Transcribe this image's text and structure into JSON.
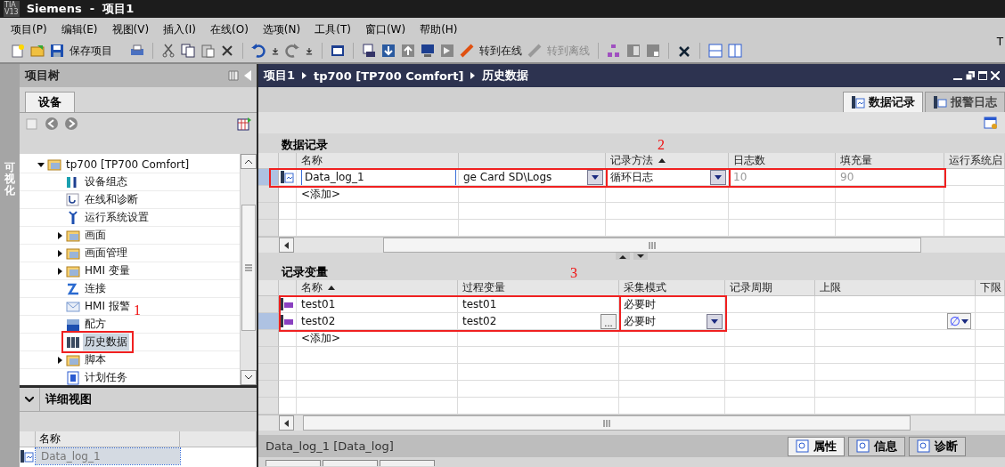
{
  "window": {
    "logo": [
      "TIA",
      "V13"
    ],
    "title": "Siemens  -  项目1"
  },
  "menu": [
    "项目(P)",
    "编辑(E)",
    "视图(V)",
    "插入(I)",
    "在线(O)",
    "选项(N)",
    "工具(T)",
    "窗口(W)",
    "帮助(H)"
  ],
  "toolbar": {
    "buttons": [
      {
        "label": "保存项目",
        "disabled": false
      },
      {
        "label": "转到在线",
        "disabled": false
      },
      {
        "label": "转到离线",
        "disabled": true
      }
    ],
    "corner_text": "T"
  },
  "side_strip": {
    "label": "可视化"
  },
  "project_tree": {
    "title": "项目树",
    "tabs": [
      {
        "label": "设备",
        "selected": true
      }
    ],
    "items": [
      {
        "label": "tp700 [TP700 Comfort]",
        "expanded": true,
        "selected": false,
        "children": [
          {
            "label": "设备组态",
            "selected": false
          },
          {
            "label": "在线和诊断",
            "selected": false
          },
          {
            "label": "运行系统设置",
            "selected": false
          },
          {
            "label": "画面",
            "expanded": false,
            "selected": false
          },
          {
            "label": "画面管理",
            "expanded": false,
            "selected": false
          },
          {
            "label": "HMI 变量",
            "expanded": false,
            "selected": false
          },
          {
            "label": "连接",
            "selected": false
          },
          {
            "label": "HMI 报警",
            "selected": false
          },
          {
            "label": "配方",
            "selected": false
          },
          {
            "label": "历史数据",
            "selected": true
          },
          {
            "label": "脚本",
            "expanded": false,
            "selected": false
          },
          {
            "label": "计划任务",
            "selected": false
          }
        ]
      }
    ]
  },
  "detail_view": {
    "title": "详细视图",
    "expanded": true,
    "columns": [
      "名称"
    ],
    "rows": [
      {
        "name": "Data_log_1",
        "selected": true
      }
    ]
  },
  "editor": {
    "breadcrumb": [
      "项目1",
      "tp700 [TP700 Comfort]",
      "历史数据"
    ],
    "tabs": [
      {
        "label": "数据记录",
        "selected": true
      },
      {
        "label": "报警日志",
        "selected": false
      }
    ],
    "data_logs": {
      "title": "数据记录",
      "columns": [
        {
          "label": "名称"
        },
        {
          "label": "记录方法",
          "sorted": true
        },
        {
          "label": "日志数"
        },
        {
          "label": "填充量"
        },
        {
          "label": "运行系统启"
        }
      ],
      "rows": [
        {
          "kind": "item",
          "selected": true,
          "cells": [
            {
              "kind": "edit",
              "text": "Data_log_1"
            },
            {
              "kind": "dropdown",
              "text": "ge Card SD\\Logs"
            },
            {
              "kind": "dropdown",
              "text": "循环日志"
            },
            {
              "kind": "disabled",
              "text": "10"
            },
            {
              "kind": "disabled",
              "text": "90"
            },
            {
              "kind": "empty"
            }
          ]
        },
        {
          "kind": "add",
          "selected": false,
          "text": "<添加>"
        }
      ]
    },
    "log_tags": {
      "title": "记录变量",
      "columns": [
        {
          "label": "名称",
          "sorted": true
        },
        {
          "label": "过程变量"
        },
        {
          "label": "采集模式"
        },
        {
          "label": "记录周期"
        },
        {
          "label": "上限"
        },
        {
          "label": "下限"
        }
      ],
      "rows": [
        {
          "kind": "item",
          "selected": false,
          "cells": [
            {
              "kind": "plain",
              "text": "test01"
            },
            {
              "kind": "plain",
              "text": "test01"
            },
            {
              "kind": "plain",
              "text": "必要时"
            },
            {
              "kind": "empty"
            },
            {
              "kind": "empty"
            },
            {
              "kind": "empty"
            }
          ]
        },
        {
          "kind": "item",
          "selected": true,
          "cells": [
            {
              "kind": "plain",
              "text": "test02"
            },
            {
              "kind": "browse",
              "text": "test02",
              "button": "..."
            },
            {
              "kind": "dropdown",
              "text": "必要时"
            },
            {
              "kind": "empty"
            },
            {
              "kind": "symbol_dropdown",
              "text": "∅"
            },
            {
              "kind": "empty"
            }
          ]
        },
        {
          "kind": "add",
          "selected": false,
          "text": "<添加>"
        }
      ]
    }
  },
  "inspector": {
    "title": "Data_log_1 [Data_log]",
    "tabs": [
      {
        "label": "属性",
        "selected": true
      },
      {
        "label": "信息",
        "selected": false
      },
      {
        "label": "诊断",
        "selected": false
      }
    ]
  },
  "annotations": [
    {
      "text": "1"
    },
    {
      "text": "2"
    },
    {
      "text": "3"
    }
  ]
}
